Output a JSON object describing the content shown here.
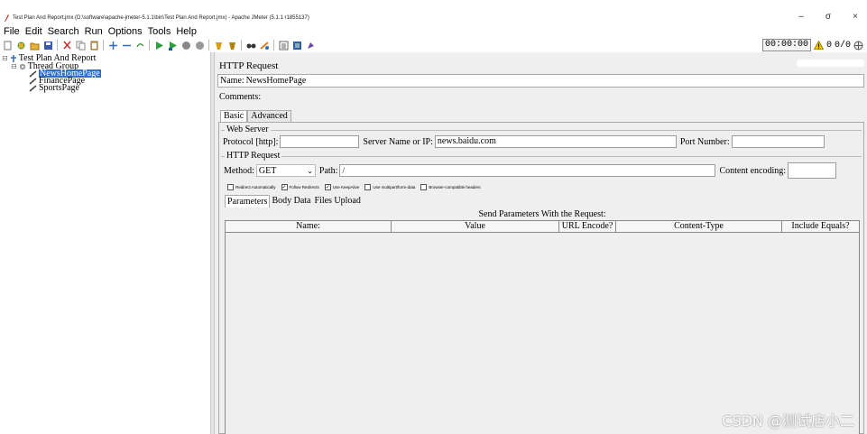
{
  "window": {
    "title": "Test Plan And Report.jmx (D:\\software\\apache-jmeter-5.1.1\\bin\\Test Plan And Report.jmx) - Apache JMeter (5.1.1 r1855137)",
    "minimize": "–",
    "maximize": "σ",
    "close": "×"
  },
  "menu": [
    "File",
    "Edit",
    "Search",
    "Run",
    "Options",
    "Tools",
    "Help"
  ],
  "toolbar": {
    "icons": [
      "new-icon",
      "templates-icon",
      "open-icon",
      "save-icon",
      "cut-icon",
      "copy-icon",
      "paste-icon",
      "expand-icon",
      "collapse-icon",
      "toggle-icon",
      "start-icon",
      "start-no-pause-icon",
      "stop-icon",
      "shutdown-icon",
      "clear-icon",
      "clear-all-icon",
      "search-icon",
      "reset-search-icon",
      "function-helper-icon",
      "help-icon",
      "remote-icon"
    ],
    "timer": "00:00:00",
    "warning_count": "0",
    "threads": "0/0"
  },
  "tree": {
    "nodes": [
      {
        "label": "Test Plan And Report",
        "selected": false
      },
      {
        "label": "Thread Group",
        "selected": false
      },
      {
        "label": "NewsHomePage",
        "selected": true
      },
      {
        "label": "FinancePage",
        "selected": false
      },
      {
        "label": "SportsPage",
        "selected": false
      }
    ]
  },
  "panel": {
    "title": "HTTP Request",
    "name_label": "Name:",
    "name_value": "NewsHomePage",
    "comments_label": "Comments:",
    "tabs": [
      "Basic",
      "Advanced"
    ],
    "web_server": {
      "legend": "Web Server",
      "protocol_label": "Protocol [http]:",
      "protocol_value": "",
      "server_label": "Server Name or IP:",
      "server_value": "news.baidu.com",
      "port_label": "Port Number:",
      "port_value": ""
    },
    "http_request": {
      "legend": "HTTP Request",
      "method_label": "Method:",
      "method_value": "GET",
      "path_label": "Path:",
      "path_value": "/",
      "encoding_label": "Content encoding:",
      "encoding_value": ""
    },
    "checkboxes": [
      {
        "label": "Redirect Automatically",
        "checked": false
      },
      {
        "label": "Follow Redirects",
        "checked": true
      },
      {
        "label": "Use KeepAlive",
        "checked": true
      },
      {
        "label": "Use multipart/form-data",
        "checked": false
      },
      {
        "label": "Browser-compatible headers",
        "checked": false
      }
    ],
    "subtabs": [
      "Parameters",
      "Body Data",
      "Files Upload"
    ],
    "params_caption": "Send Parameters With the Request:",
    "columns": [
      "Name:",
      "Value",
      "URL Encode?",
      "Content-Type",
      "Include Equals?"
    ]
  },
  "watermark": "CSDN @测试店小二"
}
